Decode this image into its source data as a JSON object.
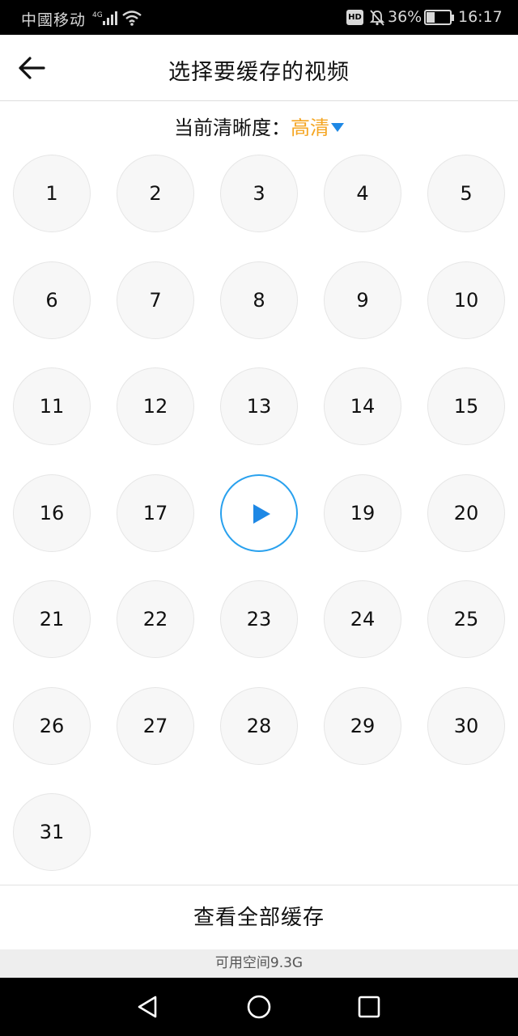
{
  "status_bar": {
    "carrier": "中國移动",
    "battery_text": "36%",
    "battery_level": 0.36,
    "time": "16:17",
    "hd_badge": "HD",
    "icons": [
      "signal-icon",
      "wifi-icon",
      "hd-icon",
      "mute-bell-icon",
      "battery-icon"
    ]
  },
  "header": {
    "title": "选择要缓存的视频",
    "back_icon": "arrow-left-icon"
  },
  "quality": {
    "label": "当前清晰度：",
    "value": "高清",
    "value_color": "#f5a623",
    "arrow_icon": "triangle-down-icon",
    "arrow_color": "#1e88e5"
  },
  "episodes": {
    "items": [
      "1",
      "2",
      "3",
      "4",
      "5",
      "6",
      "7",
      "8",
      "9",
      "10",
      "11",
      "12",
      "13",
      "14",
      "15",
      "16",
      "17",
      "18",
      "19",
      "20",
      "21",
      "22",
      "23",
      "24",
      "25",
      "26",
      "27",
      "28",
      "29",
      "30",
      "31"
    ],
    "selected": "18",
    "selected_icon": "play-icon",
    "accent_color": "#29a1ee",
    "play_color": "#1e88e5"
  },
  "footer": {
    "view_all_label": "查看全部缓存",
    "space_text": "可用空间9.3G"
  },
  "nav_bar": {
    "icons": [
      "back-triangle-icon",
      "home-circle-icon",
      "recents-square-icon"
    ]
  }
}
